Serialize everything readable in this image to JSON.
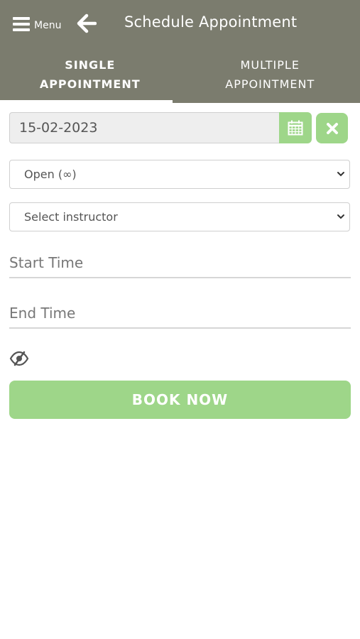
{
  "header": {
    "menu_label": "Menu",
    "title": "Schedule Appointment",
    "icons": {
      "menu": "hamburger-icon",
      "back": "arrow-left-icon"
    }
  },
  "tabs": [
    {
      "line1": "SINGLE",
      "line2": "APPOINTMENT",
      "active": true
    },
    {
      "line1": "MULTIPLE",
      "line2": "APPOINTMENT",
      "active": false
    }
  ],
  "form": {
    "date_value": "15-02-2023",
    "status_select": "Open (∞)",
    "instructor_select": "Select instructor",
    "start_time_placeholder": "Start Time",
    "end_time_placeholder": "End Time",
    "book_button": "BOOK NOW",
    "icons": {
      "calendar": "calendar-icon",
      "clear": "close-icon",
      "visibility": "eye-slash-icon"
    }
  },
  "colors": {
    "header_bg": "#7b7c6e",
    "accent_green": "#9ed689"
  }
}
